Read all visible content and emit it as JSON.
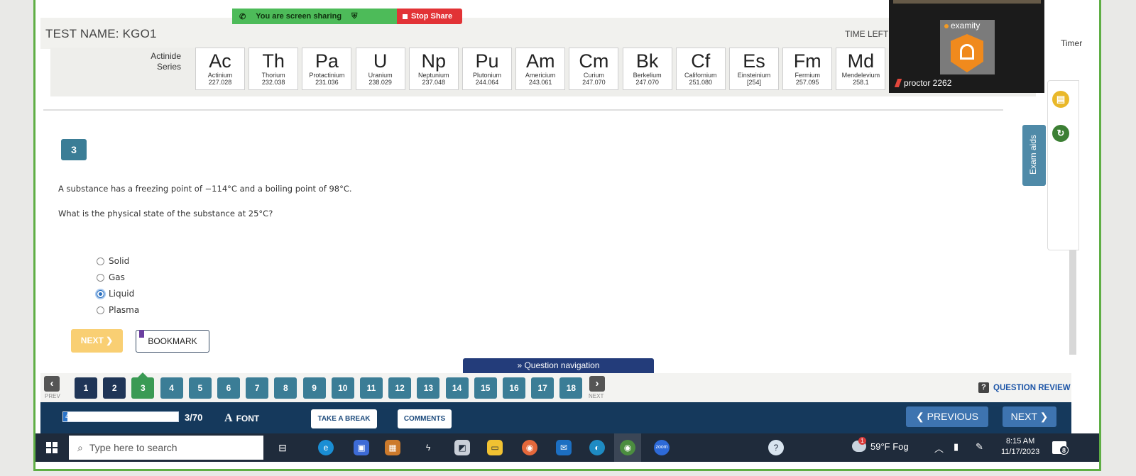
{
  "share_bar": {
    "message": "You are screen sharing",
    "stop_label": "Stop Share"
  },
  "header": {
    "test_name": "TEST NAME:  KGO1",
    "time_left_label": "TIME LEFT :",
    "timer_label": "Timer"
  },
  "periodic": {
    "series_label": "Actinide\nSeries",
    "elements": [
      {
        "sym": "Ac",
        "name": "Actinium",
        "mass": "227.028"
      },
      {
        "sym": "Th",
        "name": "Thorium",
        "mass": "232.038"
      },
      {
        "sym": "Pa",
        "name": "Protactinium",
        "mass": "231.036"
      },
      {
        "sym": "U",
        "name": "Uranium",
        "mass": "238.029"
      },
      {
        "sym": "Np",
        "name": "Neptunium",
        "mass": "237.048"
      },
      {
        "sym": "Pu",
        "name": "Plutonium",
        "mass": "244.064"
      },
      {
        "sym": "Am",
        "name": "Americium",
        "mass": "243.061"
      },
      {
        "sym": "Cm",
        "name": "Curium",
        "mass": "247.070"
      },
      {
        "sym": "Bk",
        "name": "Berkelium",
        "mass": "247.070"
      },
      {
        "sym": "Cf",
        "name": "Californium",
        "mass": "251.080"
      },
      {
        "sym": "Es",
        "name": "Einsteinium",
        "mass": "[254]"
      },
      {
        "sym": "Fm",
        "name": "Fermium",
        "mass": "257.095"
      },
      {
        "sym": "Md",
        "name": "Mendelevium",
        "mass": "258.1"
      }
    ]
  },
  "question": {
    "number": "3",
    "stem": "A substance has a freezing point of −114°C and a boiling point of 98°C.",
    "prompt": "What is the physical state of the substance at 25°C?",
    "options": [
      {
        "label": "Solid",
        "selected": false
      },
      {
        "label": "Gas",
        "selected": false
      },
      {
        "label": "Liquid",
        "selected": true
      },
      {
        "label": "Plasma",
        "selected": false
      }
    ],
    "next_label": "NEXT ❯",
    "bookmark_label": "BOOKMARK"
  },
  "exam_aids": {
    "label": "Exam aids",
    "calculator_icon": "calculator-icon",
    "refresh_icon": "refresh-icon"
  },
  "question_nav": {
    "title": "» Question navigation",
    "prev_caption": "PREV",
    "next_caption": "NEXT",
    "numbers": [
      "1",
      "2",
      "3",
      "4",
      "5",
      "6",
      "7",
      "8",
      "9",
      "10",
      "11",
      "12",
      "13",
      "14",
      "15",
      "16",
      "17",
      "18"
    ],
    "answered": [
      "1",
      "2"
    ],
    "current": "3",
    "review_label": "QUESTION REVIEW"
  },
  "bottom_bar": {
    "progress_percent": 4,
    "progress_label": "4%",
    "count": "3/70",
    "font_label": "FONT",
    "break_label": "TAKE A BREAK",
    "comments_label": "COMMENTS",
    "previous_label": "❮ PREVIOUS",
    "next_label": "NEXT ❯"
  },
  "taskbar": {
    "search_placeholder": "Type here to search",
    "weather": "59°F  Fog",
    "time": "8:15 AM",
    "date": "11/17/2023",
    "notifications": "8"
  },
  "proctor": {
    "brand": "examity",
    "name": "proctor 2262"
  },
  "colors": {
    "accent": "#3b7d96",
    "answered": "#1f3557",
    "current": "#3a9a54",
    "toolbar": "#15395c",
    "share": "#4dbb59",
    "stop": "#e23336"
  }
}
